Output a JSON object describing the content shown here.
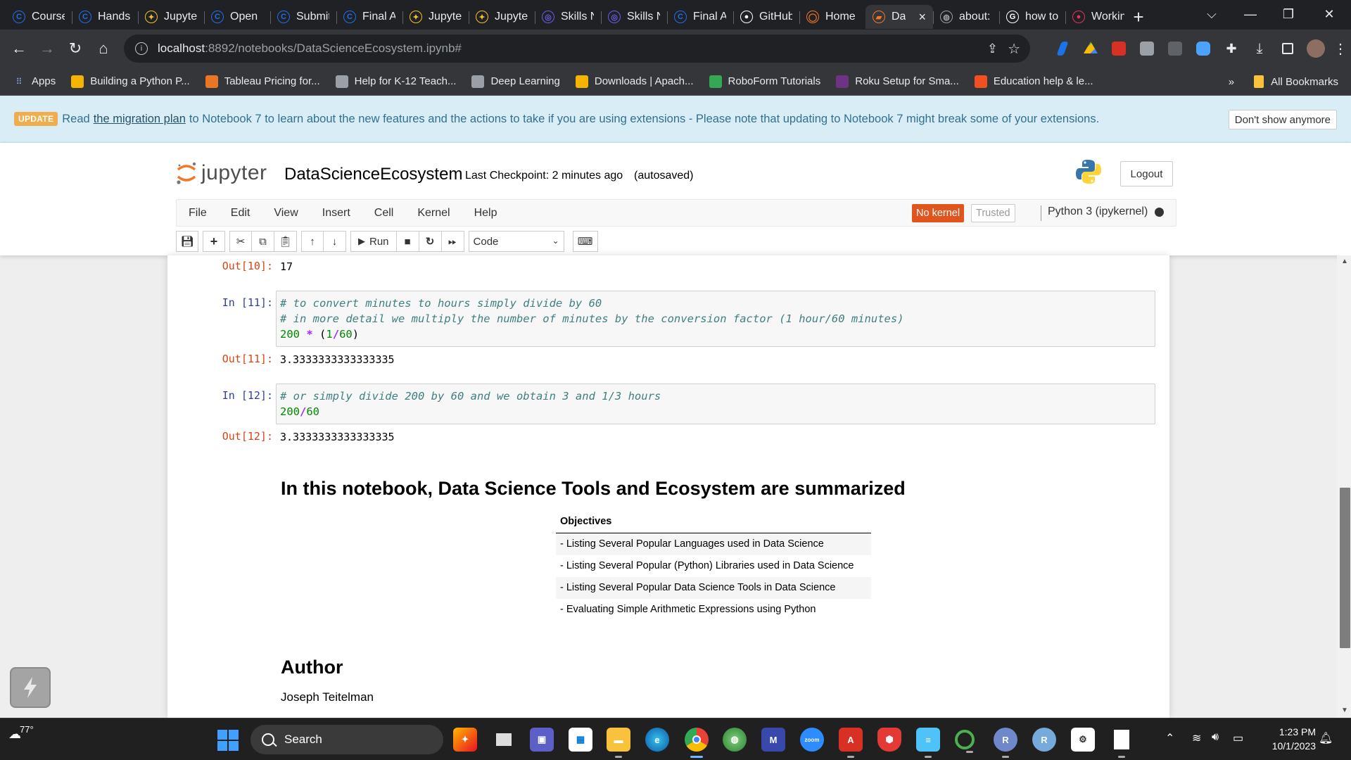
{
  "browser": {
    "tabs": [
      {
        "title": "Course",
        "icon": "coursera-icon",
        "color": "#1f6feb",
        "glyph": "C"
      },
      {
        "title": "Hands",
        "icon": "coursera-icon",
        "color": "#1f6feb",
        "glyph": "C"
      },
      {
        "title": "Jupyter",
        "icon": "lightbulb-icon",
        "color": "#f2c12e",
        "glyph": "✦"
      },
      {
        "title": "Open",
        "icon": "coursera-icon",
        "color": "#1f6feb",
        "glyph": "C"
      },
      {
        "title": "Submit",
        "icon": "coursera-icon",
        "color": "#1f6feb",
        "glyph": "C"
      },
      {
        "title": "Final A",
        "icon": "coursera-icon",
        "color": "#1f6feb",
        "glyph": "C"
      },
      {
        "title": "Jupyter",
        "icon": "lightbulb-icon",
        "color": "#f2c12e",
        "glyph": "✦"
      },
      {
        "title": "Jupyter",
        "icon": "lightbulb-icon",
        "color": "#f2c12e",
        "glyph": "✦"
      },
      {
        "title": "Skills N",
        "icon": "skills-network-icon",
        "color": "#6c5ce7",
        "glyph": "◎"
      },
      {
        "title": "Skills N",
        "icon": "skills-network-icon",
        "color": "#6c5ce7",
        "glyph": "◎"
      },
      {
        "title": "Final A",
        "icon": "coursera-icon",
        "color": "#1f6feb",
        "glyph": "C"
      },
      {
        "title": "GitHub",
        "icon": "github-icon",
        "color": "#ffffff",
        "glyph": "●"
      },
      {
        "title": "Home",
        "icon": "jupyter-icon",
        "color": "#f37626",
        "glyph": "◯"
      },
      {
        "title": "Da",
        "icon": "notebook-icon",
        "color": "#f37626",
        "glyph": "▰",
        "active": true
      },
      {
        "title": "about:",
        "icon": "globe-icon",
        "color": "#9aa0a6",
        "glyph": "◍"
      },
      {
        "title": "how to",
        "icon": "google-icon",
        "color": "#ffffff",
        "glyph": "G"
      },
      {
        "title": "Workin",
        "icon": "record-icon",
        "color": "#e8315b",
        "glyph": "●"
      }
    ],
    "url_host": "localhost",
    "url_path": ":8892/notebooks/DataScienceEcosystem.ipynb#",
    "bookmarks": [
      {
        "label": "Apps",
        "icon": "apps-grid-icon"
      },
      {
        "label": "Building a Python P...",
        "icon": "emoji-icon"
      },
      {
        "label": "Tableau Pricing for...",
        "icon": "tableau-icon"
      },
      {
        "label": "Help for K-12 Teach...",
        "icon": "globe-icon"
      },
      {
        "label": "Deep Learning",
        "icon": "globe-icon"
      },
      {
        "label": "Downloads | Apach...",
        "icon": "feather-icon"
      },
      {
        "label": "RoboForm Tutorials",
        "icon": "roboform-icon"
      },
      {
        "label": "Roku Setup for Sma...",
        "icon": "roku-icon"
      },
      {
        "label": "Education help & le...",
        "icon": "microsoft-icon"
      }
    ],
    "bookmarks_overflow": "»",
    "all_bookmarks": "All Bookmarks"
  },
  "banner": {
    "badge": "UPDATE",
    "text_before": "Read",
    "link": "the migration plan",
    "text_after": "to Notebook 7 to learn about the new features and the actions to take if you are using extensions - Please note that updating to Notebook 7 might break some of your extensions.",
    "dismiss": "Don't show anymore"
  },
  "jupyter": {
    "logo_text": "jupyter",
    "notebook_name": "DataScienceEcosystem",
    "checkpoint": "Last Checkpoint: 2 minutes ago",
    "autosaved": "(autosaved)",
    "logout": "Logout",
    "menus": [
      "File",
      "Edit",
      "View",
      "Insert",
      "Cell",
      "Kernel",
      "Help"
    ],
    "kernel_status": "No kernel",
    "trusted": "Trusted",
    "kernel_name": "Python 3 (ipykernel)",
    "run_label": "Run",
    "cell_type": "Code"
  },
  "cells": {
    "out10_prompt": "Out[10]:",
    "out10_value": "17",
    "in11_prompt": "In [11]:",
    "in11_line1": "# to convert minutes to hours simply divide by 60",
    "in11_line2": "# in more detail we multiply the number of minutes by the conversion factor (1 hour/60 minutes)",
    "in11_code": {
      "a": "200",
      "op": "*",
      "p1": "(",
      "b": "1",
      "div": "/",
      "c": "60",
      "p2": ")"
    },
    "out11_prompt": "Out[11]:",
    "out11_value": "3.3333333333333335",
    "in12_prompt": "In [12]:",
    "in12_line1": "# or simply divide 200 by 60 and we obtain 3 and 1/3 hours",
    "in12_code": {
      "a": "200",
      "div": "/",
      "b": "60"
    },
    "out12_prompt": "Out[12]:",
    "out12_value": "3.3333333333333335"
  },
  "markdown": {
    "heading": "In this notebook, Data Science Tools and Ecosystem are summarized",
    "table_header": "Objectives",
    "objectives": [
      "- Listing Several Popular Languages used in Data Science",
      "- Listing Several Popular (Python) Libraries used in Data Science",
      "- Listing Several Popular Data Science Tools in Data Science",
      "- Evaluating Simple Arithmetic Expressions using Python"
    ],
    "author_heading": "Author",
    "author_name": "Joseph Teitelman"
  },
  "taskbar": {
    "weather": "77°",
    "search": "Search",
    "time": "1:23 PM",
    "date": "10/1/2023"
  }
}
